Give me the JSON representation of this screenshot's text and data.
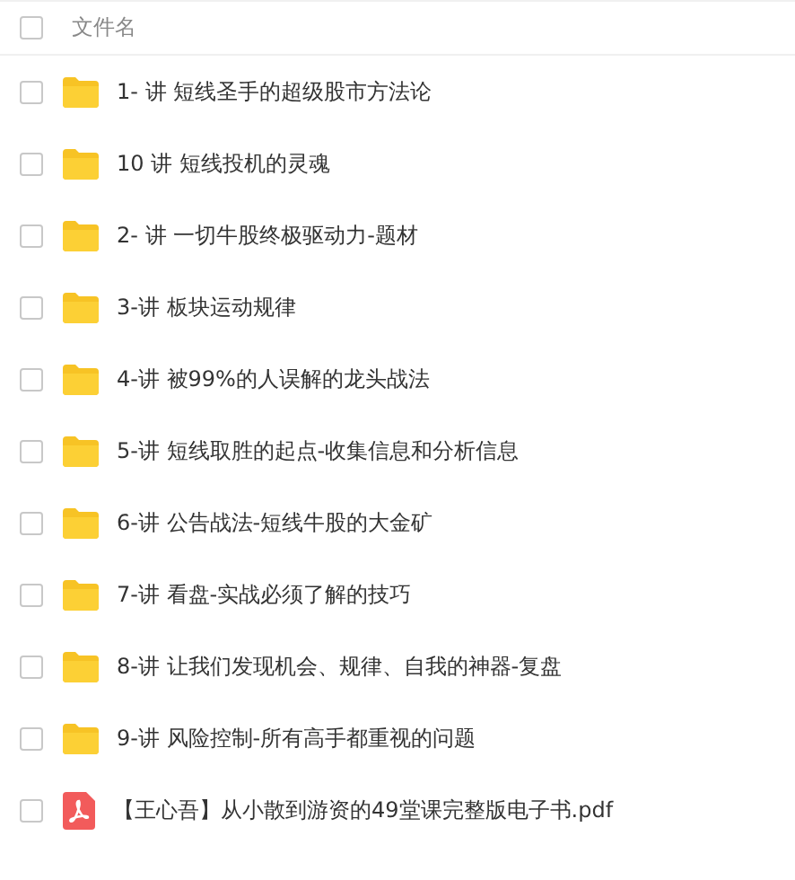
{
  "header": {
    "label": "文件名",
    "checked": false
  },
  "files": [
    {
      "kind": "folder",
      "name": "1- 讲 短线圣手的超级股市方法论",
      "checked": false
    },
    {
      "kind": "folder",
      "name": "10  讲 短线投机的灵魂",
      "checked": false
    },
    {
      "kind": "folder",
      "name": "2- 讲 一切牛股终极驱动力-题材",
      "checked": false
    },
    {
      "kind": "folder",
      "name": "3-讲 板块运动规律",
      "checked": false
    },
    {
      "kind": "folder",
      "name": "4-讲 被99%的人误解的龙头战法",
      "checked": false
    },
    {
      "kind": "folder",
      "name": "5-讲 短线取胜的起点-收集信息和分析信息",
      "checked": false
    },
    {
      "kind": "folder",
      "name": "6-讲 公告战法-短线牛股的大金矿",
      "checked": false
    },
    {
      "kind": "folder",
      "name": "7-讲 看盘-实战必须了解的技巧",
      "checked": false
    },
    {
      "kind": "folder",
      "name": "8-讲 让我们发现机会、规律、自我的神器-复盘",
      "checked": false
    },
    {
      "kind": "folder",
      "name": "9-讲 风险控制-所有高手都重视的问题",
      "checked": false
    },
    {
      "kind": "pdf",
      "name": "【王心吾】从小散到游资的49堂课完整版电子书.pdf",
      "checked": false
    }
  ]
}
